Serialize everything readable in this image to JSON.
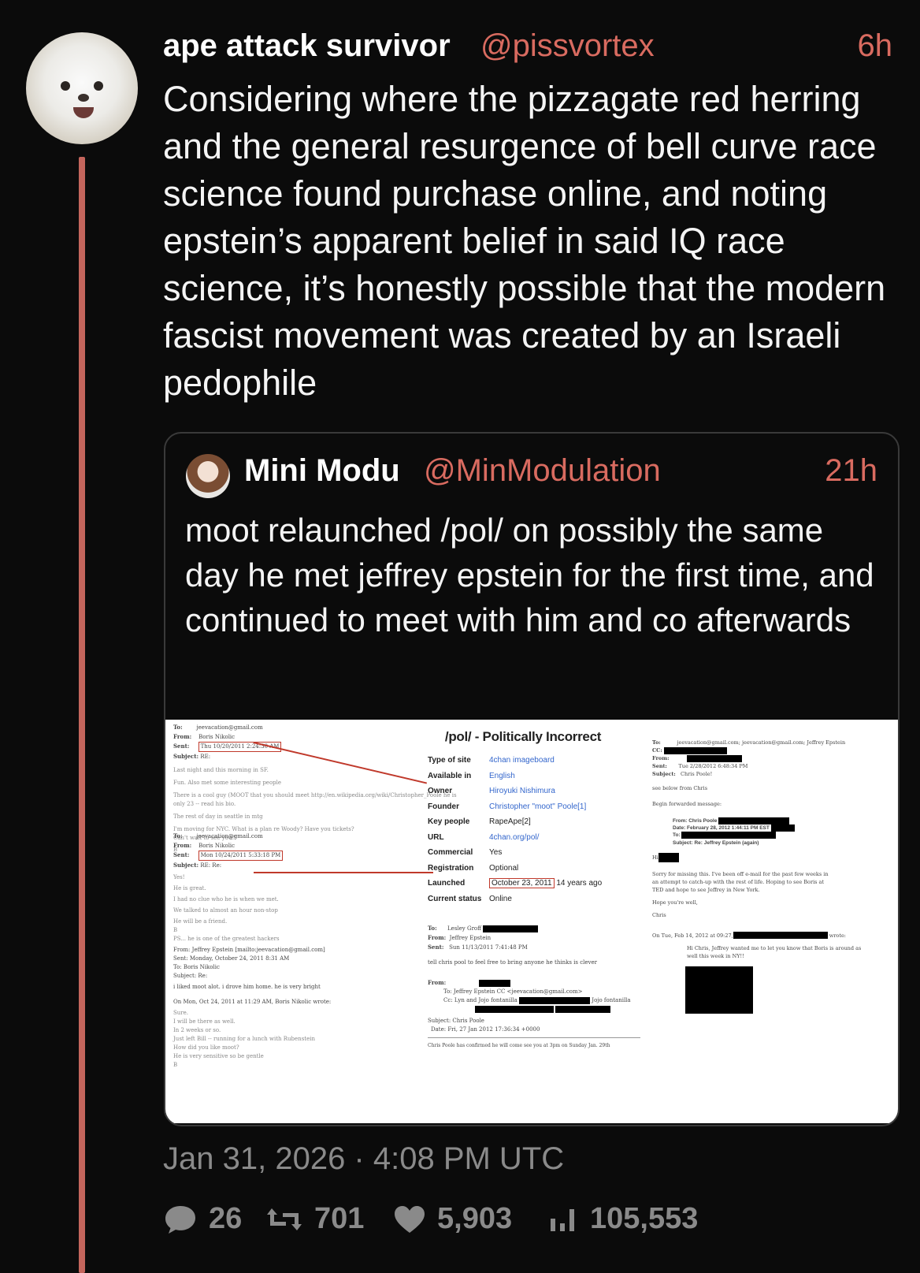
{
  "tweet": {
    "author_name": "ape attack survivor",
    "author_handle": "@pissvortex",
    "time": "6h",
    "text": "Considering where the pizzagate red herring and the general resurgence of bell curve race science found purchase online, and noting epstein’s apparent belief in said IQ race science, it’s honestly possible that the modern fascist movement was created by an Israeli pedophile",
    "avatar_icon": "dog-avatar-icon",
    "accent_color": "#d96b60",
    "thread_line_color": "#c4655c"
  },
  "quote": {
    "author_name": "Mini Modu",
    "author_handle": "@MinModulation",
    "time": "21h",
    "text": "moot relaunched /pol/ on possibly the same day he met jeffrey epstein for the first time, and continued to meet with him and co afterwards",
    "image": {
      "infobox": {
        "title": "/pol/ - Politically Incorrect",
        "rows": [
          {
            "key": "Type of site",
            "value": "4chan imageboard"
          },
          {
            "key": "Available in",
            "value": "English"
          },
          {
            "key": "Owner",
            "value": "Hiroyuki Nishimura"
          },
          {
            "key": "Founder",
            "value": "Christopher \"moot\" Poole[1]"
          },
          {
            "key": "Key people",
            "value": "RapeApe[2]"
          },
          {
            "key": "URL",
            "value": "4chan.org/pol/"
          },
          {
            "key": "Commercial",
            "value": "Yes"
          },
          {
            "key": "Registration",
            "value": "Optional"
          },
          {
            "key": "Launched",
            "value": "October 23, 2011",
            "extra": "14 years ago"
          },
          {
            "key": "Current status",
            "value": "Online"
          }
        ]
      },
      "left_email_1": {
        "to": "jeevacation@gmail.com",
        "from": "Boris Nikolic",
        "sent": "Thu 10/20/2011 2:24:30 AM",
        "subject": "RE:",
        "lines": [
          "Last night and this morning in SF.",
          "Fun. Also met some interesting people",
          "There is a cool guy (MOOT that you should meet http://en.wikipedia.org/wiki/Christopher_Poole he is",
          "only 23 -- read his bio.",
          "The rest of day in seattle in mtg",
          "I'm moving for NYC. What is a plan re Woody? Have you tickets?",
          "Can't wait to see you!!",
          "B"
        ]
      },
      "left_email_2": {
        "to": "jeevacation@gmail.com",
        "from": "Boris Nikolic",
        "sent": "Mon 10/24/2011 5:33:18 PM",
        "subject": "RE: Re:",
        "lines": [
          "Yes!",
          "He is great.",
          "I had no clue who he is when we met.",
          "We talked to almost an hour non-stop",
          "He will be a friend.",
          "B",
          "PS... he is one of the greatest hackers",
          "From: Jeffrey Epstein [mailto:jeevacation@gmail.com]",
          "Sent: Monday, October 24, 2011 8:31 AM",
          "To: Boris Nikolic",
          "Subject: Re:",
          "i liked moot alot. i drove him home. he is very bright",
          "On Mon, Oct 24, 2011 at 11:29 AM, Boris Nikolic wrote:",
          "Sure.",
          "I will be there as well.",
          "In 2 weeks or so.",
          "Just left Bill -- running for a lunch with Rubenstein",
          "How did you like moot?",
          "He is very sensitive so be gentle",
          "B"
        ]
      },
      "middle_email": {
        "to": "Lesley Groff",
        "from": "Jeffrey Epstein",
        "sent": "Sun 11/13/2011 7:41:48 PM",
        "line": "tell chris pool to feel free to bring anyone he thinks is clever",
        "fwd_to": "To: Jeffrey Epstein CC <jeevacation@gmail.com>",
        "fwd_cc": "Cc: Lyn and Jojo fontanilla",
        "fwd_cc_tail": "Jojo fontanilla",
        "fwd_subject": "Subject: Chris Poole",
        "fwd_date": "Date: Fri, 27 Jan 2012 17:36:34 +0000",
        "fwd_body": "Chris Poole has confirmed he will come see you at 3pm on Sunday Jan. 29th"
      },
      "right_email": {
        "to": "jeevacation@gmail.com; jeevacation@gmail.com; Jeffrey Epstein",
        "from": "",
        "sent": "Tue 2/28/2012 6:48:34 PM",
        "subject": "Chris Poole!",
        "lines": [
          "see below from Chris",
          "Begin forwarded message:"
        ],
        "inner_from": "From: Chris Poole",
        "inner_date": "Date: February 28, 2012 1:44:11 PM EST",
        "inner_to": "To:",
        "inner_subject": "Subject: Re: Jeffrey Epstein (again)",
        "hi": "Hi",
        "body": [
          "Sorry for missing this. I've been off e-mail for the past few weeks in",
          "an attempt to catch-up with the rest of life. Hoping to see Boris at",
          "TED and hope to see Jeffrey in New York."
        ],
        "closing": [
          "Hope you're well,",
          "Chris"
        ],
        "quoted_header": "On Tue, Feb 14, 2012 at 09:27,",
        "quoted_tail": "wrote:",
        "quoted_body": [
          "Hi Chris, Jeffrey wanted me to let you know that Boris is around as",
          "well this week in NY!!"
        ]
      }
    }
  },
  "footer": {
    "date": "Jan 31, 2026 · 4:08 PM UTC",
    "replies": "26",
    "retweets": "701",
    "likes": "5,903",
    "views": "105,553"
  }
}
